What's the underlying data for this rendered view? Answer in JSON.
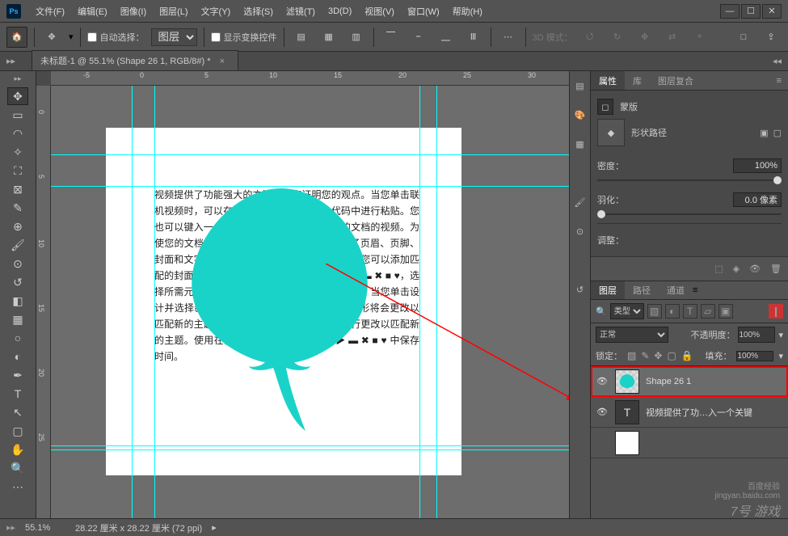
{
  "app_icon": "Ps",
  "menu": [
    "文件(F)",
    "编辑(E)",
    "图像(I)",
    "图层(L)",
    "文字(Y)",
    "选择(S)",
    "滤镜(T)",
    "3D(D)",
    "视图(V)",
    "窗口(W)",
    "帮助(H)"
  ],
  "optbar": {
    "auto_select": "自动选择：",
    "layer_dropdown": "图层",
    "show_transform": "显示变换控件",
    "mode3d": "3D 模式："
  },
  "tab": {
    "title": "未标题-1 @ 55.1% (Shape 26 1, RGB/8#) *"
  },
  "ruler_marks": [
    "-5",
    "0",
    "5",
    "10",
    "15",
    "20",
    "25",
    "30"
  ],
  "body_text": "视频提供了功能强大的方法帮助您证明您的观点。当您单击联机视频时，可以在想要添加的视频的嵌入代码中进行粘贴。您也可以键入一个关键字以联机搜索最适合您的文档的视频。为使您的文档具有专业外观。\n▶ ▬ ✖ ■ ♥ 提供了页眉、页脚、封面和文字设计，这些设计可互为补充。例如，您可以添加匹配的封面、页眉和提要栏。单击\"▶ ▬ ✖ ■ ♥\"▶ ▬ ✖ ■ ♥，选择所需元素。主题和样式也有助于文档保持协调。当您单击设计并选择新的主题时，\"▶✖■♥ ▶ ▼ ✖ ■ ♥\"\n图形将会更改以匹配新的主题。当应用样式时，您的标题会进行更改以匹配新的主题。使用在需要位置出现的新按钮在 ▶ ▬ ✖ ■ ♥ 中保存时间。",
  "panels": {
    "props_tabs": [
      "属性",
      "库",
      "图层复合"
    ],
    "mask_label": "蒙版",
    "shape_path": "形状路径",
    "density_label": "密度：",
    "density_value": "100%",
    "feather_label": "羽化：",
    "feather_value": "0.0 像素",
    "adjust_label": "调整："
  },
  "layers": {
    "tabs": [
      "图层",
      "路径",
      "通道"
    ],
    "filter_label": "类型",
    "blend_mode": "正常",
    "opacity_label": "不透明度：",
    "opacity_value": "100%",
    "lock_label": "锁定：",
    "fill_label": "填充：",
    "fill_value": "100%",
    "items": [
      {
        "name": "Shape 26 1",
        "type": "shape"
      },
      {
        "name": "视频提供了功…入一个关键",
        "type": "text"
      },
      {
        "name": "",
        "type": "bg"
      }
    ]
  },
  "status": {
    "zoom": "55.1%",
    "doc": "28.22 厘米 x 28.22 厘米 (72 ppi)"
  },
  "watermark": {
    "l1": "百度经验",
    "l2": "jingyan.baidu.com",
    "l3": "7号 游戏"
  }
}
